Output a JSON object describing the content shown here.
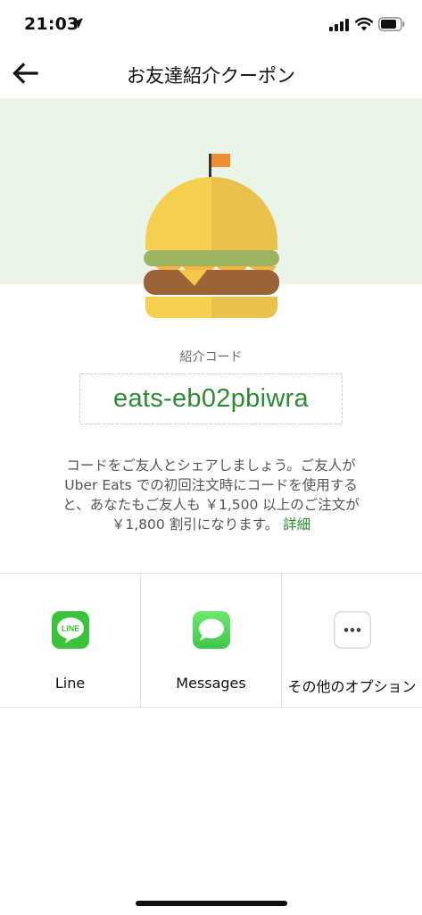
{
  "status_bar": {
    "time": "21:03",
    "icons": [
      "location-arrow-icon",
      "cellular-signal-icon",
      "wifi-icon",
      "battery-icon"
    ]
  },
  "nav": {
    "title": "お友達紹介クーポン",
    "back_icon": "arrow-left-icon"
  },
  "hero": {
    "illustration": "burger-with-flag",
    "band_color": "#eaf4e7"
  },
  "referral": {
    "code_label": "紹介コード",
    "code": "eats-eb02pbiwra"
  },
  "description": {
    "line1": "コードをご友人とシェアしましょう。ご友人が",
    "line2": "Uber Eats での初回注文時にコードを使用する",
    "line3": "と、あなたもご友人も ￥1,500 以上のご注文が",
    "line4": "￥1,800 割引になります。",
    "detail_link": "詳細"
  },
  "share_options": [
    {
      "label": "Line",
      "icon": "line-app-icon"
    },
    {
      "label": "Messages",
      "icon": "messages-app-icon"
    },
    {
      "label": "その他のオプション",
      "icon": "more-options-icon"
    }
  ],
  "colors": {
    "accent_green": "#2e8b35",
    "line_green": "#3ac33a",
    "messages_green": "#4fd35c"
  }
}
